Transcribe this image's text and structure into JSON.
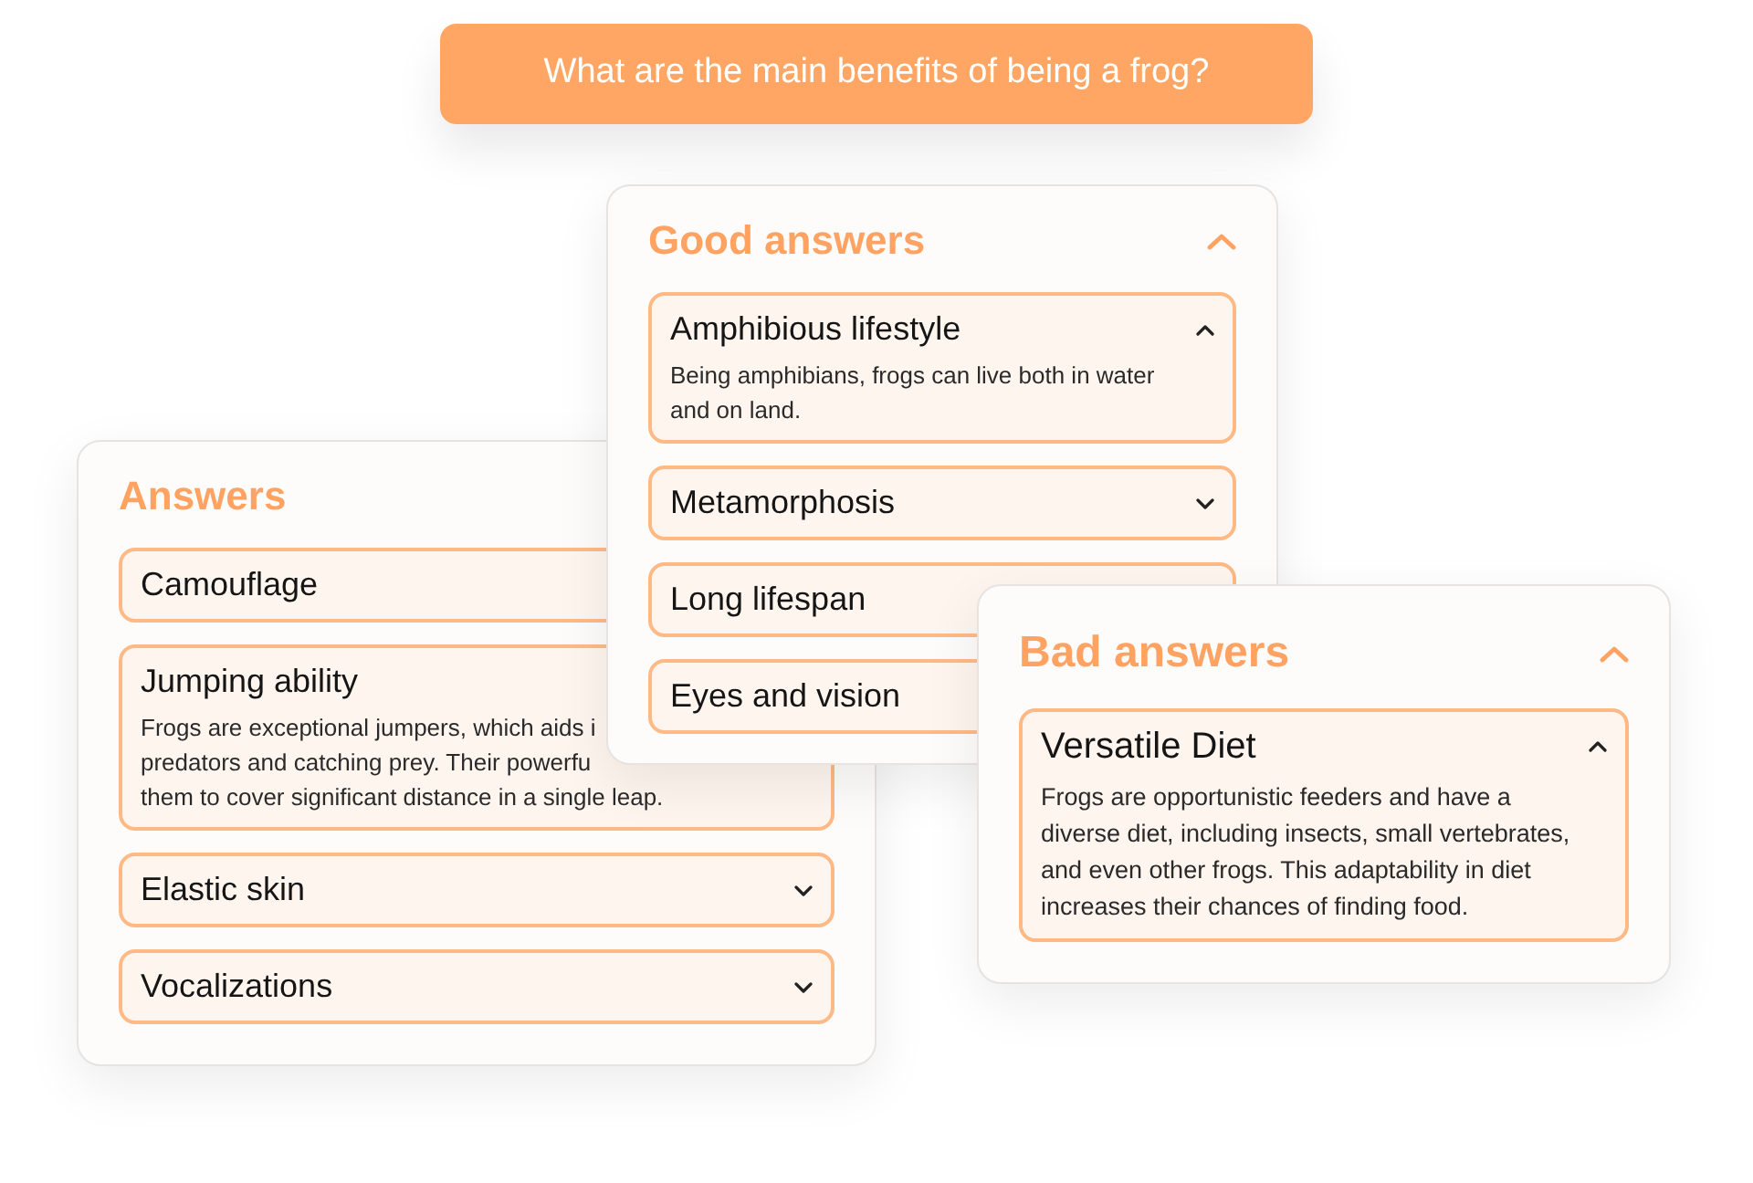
{
  "question": {
    "text": "What are the main benefits of being a frog?"
  },
  "panels": [
    {
      "title": "Answers",
      "items": [
        {
          "title": "Camouflage"
        },
        {
          "title": "Jumping ability",
          "expanded": true,
          "description_lines": [
            "Frogs are exceptional jumpers, which aids i",
            "predators and catching prey. Their powerfu",
            "them to cover significant distance in a single leap."
          ]
        },
        {
          "title": "Elastic skin",
          "expanded": false
        },
        {
          "title": "Vocalizations",
          "expanded": false
        }
      ]
    },
    {
      "title": "Good answers",
      "expanded": true,
      "items": [
        {
          "title": "Amphibious lifestyle",
          "expanded": true,
          "description": "Being amphibians, frogs can live both in water and on land."
        },
        {
          "title": "Metamorphosis",
          "expanded": false
        },
        {
          "title": "Long lifespan"
        },
        {
          "title": "Eyes and vision"
        }
      ]
    },
    {
      "title": "Bad answers",
      "expanded": true,
      "items": [
        {
          "title": "Versatile Diet",
          "expanded": true,
          "description": "Frogs are opportunistic feeders and have a diverse diet, including insects, small vertebrates, and even other frogs. This adaptability in diet increases their chances of finding food."
        }
      ]
    }
  ]
}
